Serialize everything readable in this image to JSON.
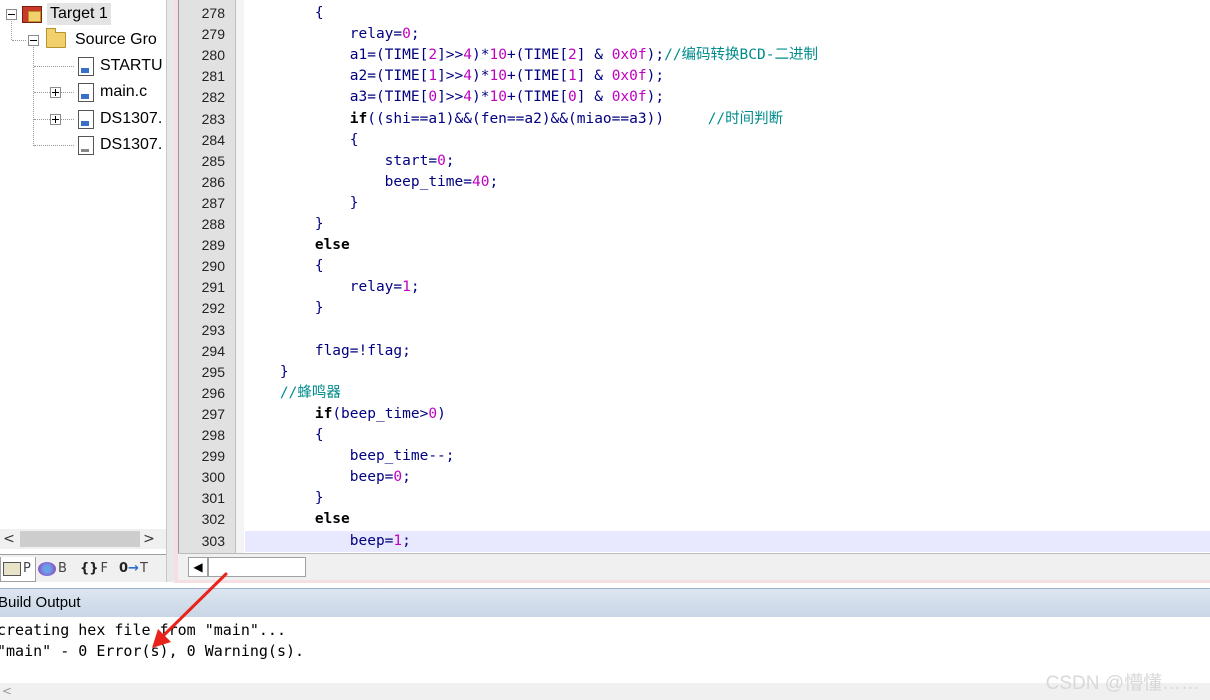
{
  "project_tree": {
    "items": [
      {
        "label": "Target 1",
        "kind": "target"
      },
      {
        "label": "Source Gro",
        "kind": "group"
      },
      {
        "label": "STARTU",
        "kind": "file"
      },
      {
        "label": "main.c",
        "kind": "file"
      },
      {
        "label": "DS1307.",
        "kind": "file"
      },
      {
        "label": "DS1307.",
        "kind": "header"
      }
    ]
  },
  "tree_scroll": {
    "left": "<",
    "right": ">"
  },
  "panel_tabs": [
    {
      "label": "P",
      "icon": "project-icon"
    },
    {
      "label": "B",
      "icon": "books-icon"
    },
    {
      "label": "F",
      "icon": "functions-icon"
    },
    {
      "label": "T",
      "icon": "templates-icon"
    }
  ],
  "editor": {
    "lines": [
      {
        "n": "278",
        "code": "        {"
      },
      {
        "n": "279",
        "code": "            relay=0;"
      },
      {
        "n": "280",
        "code": "            a1=(TIME[2]>>4)*10+(TIME[2] & 0x0f);//编码转换BCD-二进制"
      },
      {
        "n": "281",
        "code": "            a2=(TIME[1]>>4)*10+(TIME[1] & 0x0f);"
      },
      {
        "n": "282",
        "code": "            a3=(TIME[0]>>4)*10+(TIME[0] & 0x0f);"
      },
      {
        "n": "283",
        "code": "            if((shi==a1)&&(fen==a2)&&(miao==a3))     //时间判断"
      },
      {
        "n": "284",
        "code": "            {"
      },
      {
        "n": "285",
        "code": "                start=0;"
      },
      {
        "n": "286",
        "code": "                beep_time=40;"
      },
      {
        "n": "287",
        "code": "            }"
      },
      {
        "n": "288",
        "code": "        }"
      },
      {
        "n": "289",
        "code": "        else"
      },
      {
        "n": "290",
        "code": "        {"
      },
      {
        "n": "291",
        "code": "            relay=1;"
      },
      {
        "n": "292",
        "code": "        }"
      },
      {
        "n": "293",
        "code": ""
      },
      {
        "n": "294",
        "code": "        flag=!flag;"
      },
      {
        "n": "295",
        "code": "    }"
      },
      {
        "n": "296",
        "code": "    //蜂鸣器"
      },
      {
        "n": "297",
        "code": "        if(beep_time>0)"
      },
      {
        "n": "298",
        "code": "        {"
      },
      {
        "n": "299",
        "code": "            beep_time--;"
      },
      {
        "n": "300",
        "code": "            beep=0;"
      },
      {
        "n": "301",
        "code": "        }"
      },
      {
        "n": "302",
        "code": "        else"
      },
      {
        "n": "303",
        "code": "            beep=1;"
      }
    ],
    "current_line": "303",
    "hscroll_arrow": "◀"
  },
  "build_output": {
    "title": "Build Output",
    "lines": [
      "creating hex file from \"main\"...",
      "\"main\" - 0 Error(s), 0 Warning(s)."
    ]
  },
  "watermark": "CSDN @懵懂……",
  "colors": {
    "keyword": "#000000",
    "identifier": "#000080",
    "number": "#c000c0",
    "comment": "#008b8b",
    "annotation_arrow": "#e8231a"
  }
}
